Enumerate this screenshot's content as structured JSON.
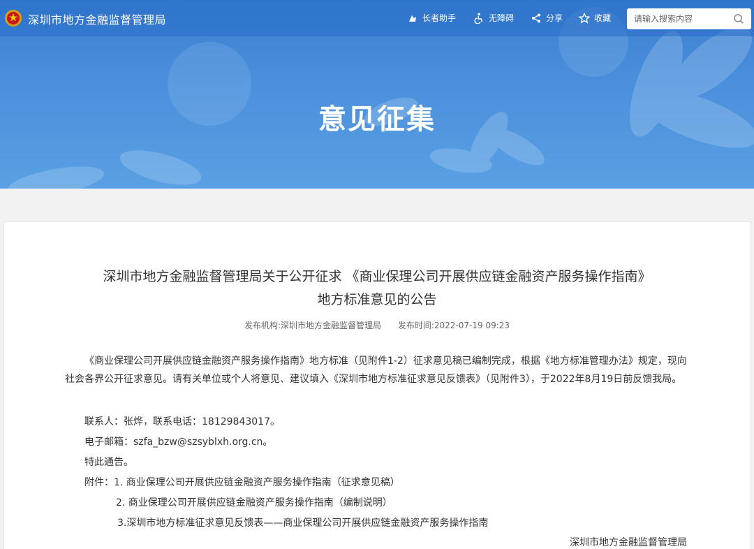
{
  "header": {
    "site_title": "深圳市地方金融监督管理局",
    "tools": [
      {
        "label": "长者助手",
        "icon": "elder-assist-icon"
      },
      {
        "label": "无障碍",
        "icon": "accessibility-icon"
      },
      {
        "label": "分享",
        "icon": "share-icon"
      },
      {
        "label": "收藏",
        "icon": "star-icon"
      }
    ],
    "search": {
      "placeholder": "请输入搜索内容",
      "icon": "search-icon"
    }
  },
  "banner": {
    "title": "意见征集"
  },
  "article": {
    "title_line1": "深圳市地方金融监督管理局关于公开征求 《商业保理公司开展供应链金融资产服务操作指南》",
    "title_line2": "地方标准意见的公告",
    "publisher_label": "发布机构:",
    "publisher": "深圳市地方金融监督管理局",
    "time_label": "发布时间:",
    "time": "2022-07-19 09:23",
    "paragraph": "《商业保理公司开展供应链金融资产服务操作指南》地方标准（见附件1-2）征求意见稿已编制完成，根据《地方标准管理办法》规定，现向社会各界公开征求意见。请有关单位或个人将意见、建议填入《深圳市地方标准征求意见反馈表》（见附件3），于2022年8月19日前反馈我局。",
    "contact": "联系人：张烨，联系电话：18129843017。",
    "email": "电子邮箱：szfa_bzw@szsyblxh.org.cn。",
    "notice": "特此通告。",
    "attachments_label": "附件：",
    "attachments": [
      "1. 商业保理公司开展供应链金融资产服务操作指南（征求意见稿）",
      "2. 商业保理公司开展供应链金融资产服务操作指南（编制说明）",
      "3.深圳市地方标准征求意见反馈表——商业保理公司开展供应链金融资产服务操作指南"
    ],
    "signature": "深圳市地方金融监督管理局"
  },
  "colors": {
    "banner": "#4a90dc",
    "topbar": "#3a7fd0"
  }
}
